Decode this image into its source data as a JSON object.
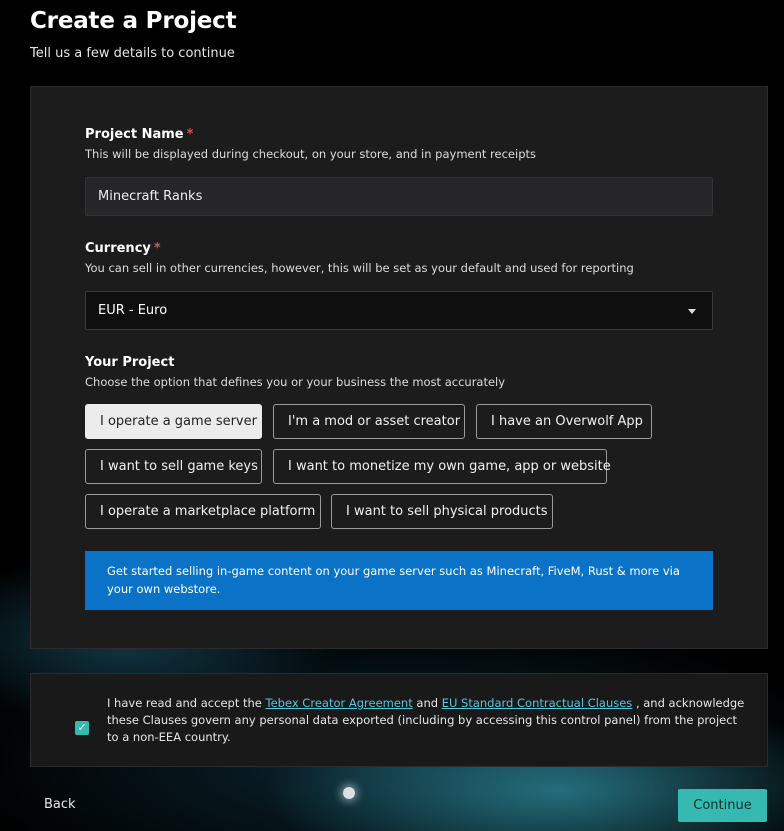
{
  "header": {
    "title": "Create a Project",
    "subtitle": "Tell us a few details to continue"
  },
  "project_name": {
    "label": "Project Name",
    "required_mark": "*",
    "help": "This will be displayed during checkout, on your store, and in payment receipts",
    "value": "Minecraft Ranks"
  },
  "currency": {
    "label": "Currency",
    "required_mark": "*",
    "help": "You can sell in other currencies, however, this will be set as your default and used for reporting",
    "selected": "EUR - Euro"
  },
  "your_project": {
    "label": "Your Project",
    "help": "Choose the option that defines you or your business the most accurately",
    "options": [
      "I operate a game server",
      "I'm a mod or asset creator",
      "I have an Overwolf App",
      "I want to sell game keys",
      "I want to monetize my own game, app or website",
      "I operate a marketplace platform",
      "I want to sell physical products"
    ],
    "selected_index": 0,
    "info": "Get started selling in-game content on your game server such as Minecraft, FiveM, Rust & more via your own webstore."
  },
  "consent": {
    "checked": true,
    "check_glyph": "✓",
    "text_before": "I have read and accept the ",
    "link1": "Tebex Creator Agreement",
    "text_mid": " and ",
    "link2": "EU Standard Contractual Clauses",
    "text_after": " , and acknowledge these Clauses govern any personal data exported (including by accessing this control panel) from the project to a non-EEA country."
  },
  "footer": {
    "back_label": "Back",
    "continue_label": "Continue"
  },
  "colors": {
    "accent": "#36b9b1",
    "info_bg": "#0a73c7",
    "required": "#d9534f"
  }
}
